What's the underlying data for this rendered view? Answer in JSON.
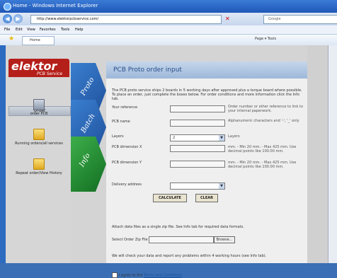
{
  "window": {
    "title": "Home - Windows Internet Explorer"
  },
  "address": {
    "url": "http://www.elektorpcbservice.com/",
    "search_placeholder": "Google"
  },
  "menu": [
    "File",
    "Edit",
    "View",
    "Favorites",
    "Tools",
    "Help"
  ],
  "tab": {
    "label": "Home"
  },
  "toolbar": {
    "tools": "Page ▾  Tools"
  },
  "logo": {
    "name": "elektor",
    "sub": "PCB Service"
  },
  "sidebar": {
    "header": "Order",
    "items": [
      {
        "label": "order PCB",
        "icon": "circuit-board-icon"
      },
      {
        "label": "Running orders/all services",
        "icon": "folder-icon"
      },
      {
        "label": "Repeat order/View History",
        "icon": "folder-icon"
      }
    ]
  },
  "ribbons": [
    {
      "label": "Proto",
      "color": "#2f6fc0"
    },
    {
      "label": "Batch",
      "color": "#2f6fc0"
    },
    {
      "label": "Info",
      "color": "#1e8a30"
    }
  ],
  "form": {
    "title": "PCB Proto order input",
    "intro": "The PCB proto service ships 2 boards in 5 working days after approved plus a torque board where possible. To place an order, just complete the boxes below. For order conditions and more information click the Info tab.",
    "your_reference_label": "Your reference",
    "your_reference_note": "Order number or other reference to link to your internal paperwork.",
    "pcb_name_label": "PCB name",
    "pcb_name_note": "Alphanumeric characters and '-', '_' only",
    "layers_label": "Layers",
    "layers_value": "2",
    "layers_note": "Layers",
    "dim_x_label": "PCB dimension X",
    "dim_x_note": "mm. - Min 20 mm. - Max 425 mm. Use decimal points like 100.00 mm.",
    "dim_y_label": "PCB dimension Y",
    "dim_y_note": "mm. - Min 20 mm. - Max 425 mm. Use decimal points like 100.00 mm.",
    "delivery_label": "Delivery address",
    "delivery_value": "",
    "calculate_label": "CALCULATE",
    "clear_label": "CLEAR",
    "attach_text": "Attach data files as a single zip file. See Info tab for required data formats.",
    "file_label": "Select Order Zip File",
    "browse_label": "Browse...",
    "check_text": "We will check your data and report any problems within 4 working hours (see Info tab).",
    "agree_text": "I agree to the",
    "terms_link": "Terms and Conditions"
  }
}
